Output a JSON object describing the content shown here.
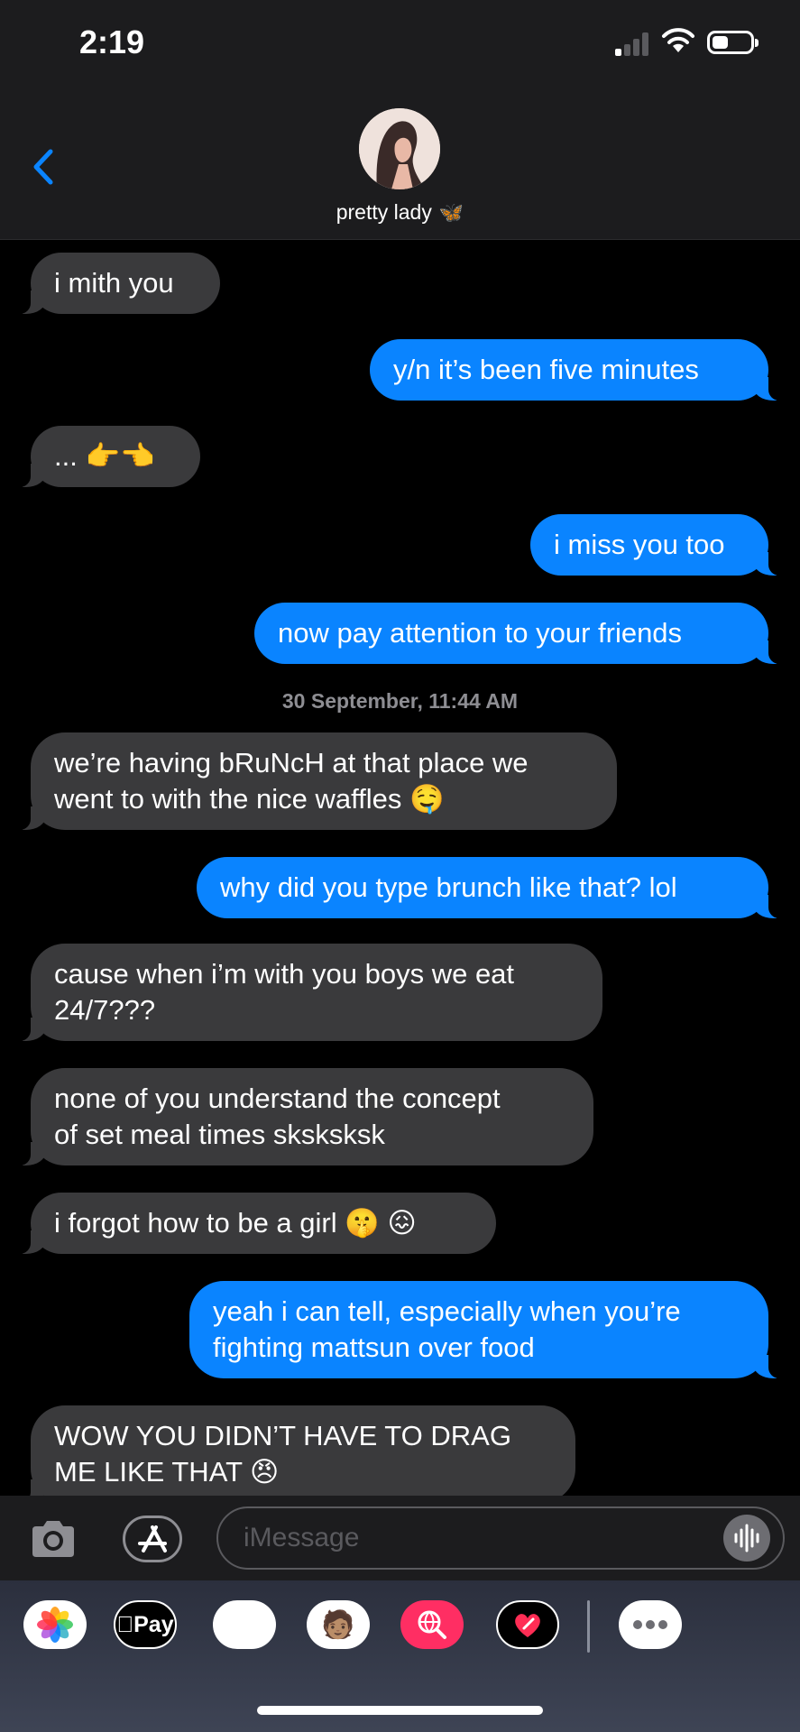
{
  "status_bar": {
    "time": "2:19"
  },
  "contact": {
    "name": "pretty lady",
    "badge": "🦋"
  },
  "messages": [
    {
      "from": "them",
      "lines": [
        "i mith you"
      ]
    },
    {
      "from": "me",
      "lines": [
        "y/n it’s been five minutes"
      ]
    },
    {
      "from": "them",
      "lines": [
        "... 👉👈"
      ]
    },
    {
      "from": "me",
      "lines": [
        "i miss you too"
      ]
    },
    {
      "from": "me",
      "lines": [
        "now pay attention to your friends"
      ]
    },
    {
      "from": "them",
      "lines": [
        "we’re having bRuNcH at that place we",
        "went to with the nice waffles 🤤"
      ]
    },
    {
      "from": "me",
      "lines": [
        "why did you type brunch like that? lol"
      ]
    },
    {
      "from": "them",
      "lines": [
        "cause when i’m with you boys we eat",
        "24/7???"
      ]
    },
    {
      "from": "them",
      "lines": [
        "none of you understand the concept",
        "of set meal times sksksksk"
      ]
    },
    {
      "from": "them",
      "lines": [
        "i forgot how to be a girl 🤫 😖"
      ]
    },
    {
      "from": "me",
      "lines": [
        "yeah i can tell, especially when you’re",
        "fighting mattsun over food"
      ]
    },
    {
      "from": "them",
      "lines": [
        "WOW YOU DIDN’T HAVE TO DRAG",
        "ME LIKE THAT 😠"
      ]
    }
  ],
  "timestamp": "30 September, 11:44 AM",
  "input": {
    "placeholder": "iMessage"
  },
  "apps": {
    "applepay_label": "Pay",
    "icons": [
      "photos-icon",
      "apple-pay-icon",
      "animoji-icon",
      "memoji-icon",
      "image-search-icon",
      "digital-touch-icon",
      "more-icon"
    ]
  },
  "colors": {
    "outgoing": "#0a84ff",
    "incoming": "#3a3a3c",
    "background": "#000000"
  }
}
